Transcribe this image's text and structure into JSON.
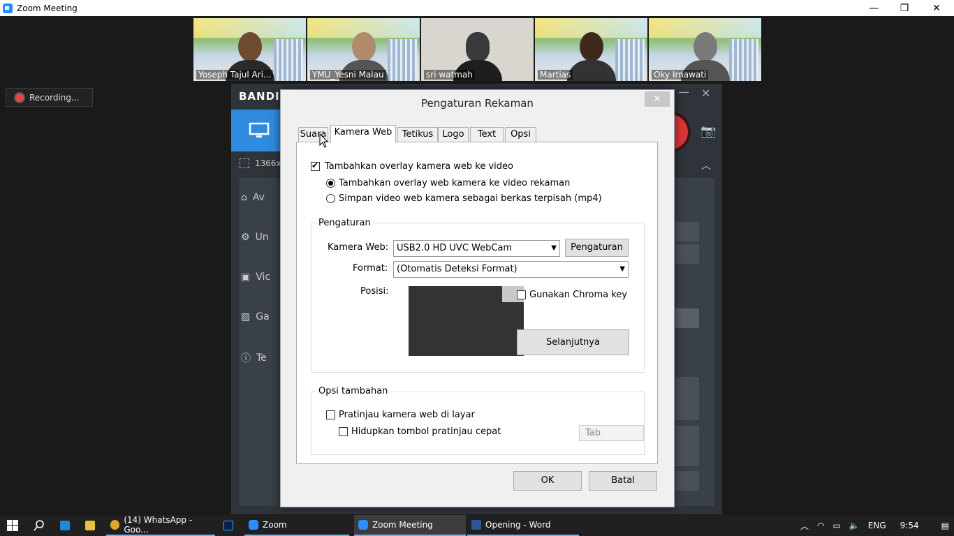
{
  "window": {
    "title": "Zoom Meeting",
    "min": "—",
    "restore": "❐",
    "close": "✕"
  },
  "recording": {
    "label": "Recording..."
  },
  "participants": [
    {
      "name": "Yoseph Tajul Ari..."
    },
    {
      "name": "YMU_Yesni Malau"
    },
    {
      "name": "sri watmah"
    },
    {
      "name": "Martias"
    },
    {
      "name": "Oky Irnawati"
    }
  ],
  "bandicam": {
    "logo": "BANDI",
    "resolution": "1366x",
    "sidebar": [
      "Av",
      "Un",
      "Vic",
      "Ga",
      "Te"
    ]
  },
  "dialog": {
    "title": "Pengaturan Rekaman",
    "close": "✕",
    "tabs": [
      "Suara",
      "Kamera Web",
      "Tetikus",
      "Logo",
      "Text",
      "Opsi"
    ],
    "active_tab": "Kamera Web",
    "overlay_checkbox": {
      "label": "Tambahkan overlay kamera web ke video",
      "checked": true
    },
    "radio_overlay": {
      "label": "Tambahkan overlay web kamera ke video rekaman",
      "selected": true
    },
    "radio_separate": {
      "label": "Simpan video web kamera sebagai berkas terpisah (mp4)",
      "selected": false
    },
    "settings_group": {
      "title": "Pengaturan",
      "webcam_label": "Kamera Web:",
      "webcam_value": "USB2.0 HD UVC WebCam",
      "settings_button": "Pengaturan",
      "format_label": "Format:",
      "format_value": "(Otomatis Deteksi Format)",
      "position_label": "Posisi:",
      "chroma_label": "Gunakan Chroma key",
      "next_button": "Selanjutnya"
    },
    "extra_group": {
      "title": "Opsi tambahan",
      "preview_label": "Pratinjau kamera web di layar",
      "quick_label": "Hidupkan tombol pratinjau cepat",
      "tab_field": "Tab"
    },
    "ok": "OK",
    "cancel": "Batal"
  },
  "taskbar": {
    "items": [
      {
        "label": "(14) WhatsApp - Goo...",
        "color": "#e0a52a"
      },
      {
        "label": "Zoom",
        "color": "#2d8cff"
      },
      {
        "label": "Zoom Meeting",
        "color": "#2d8cff"
      },
      {
        "label": "Opening - Word",
        "color": "#2b5797"
      }
    ],
    "lang": "ENG",
    "time": "9:54"
  }
}
